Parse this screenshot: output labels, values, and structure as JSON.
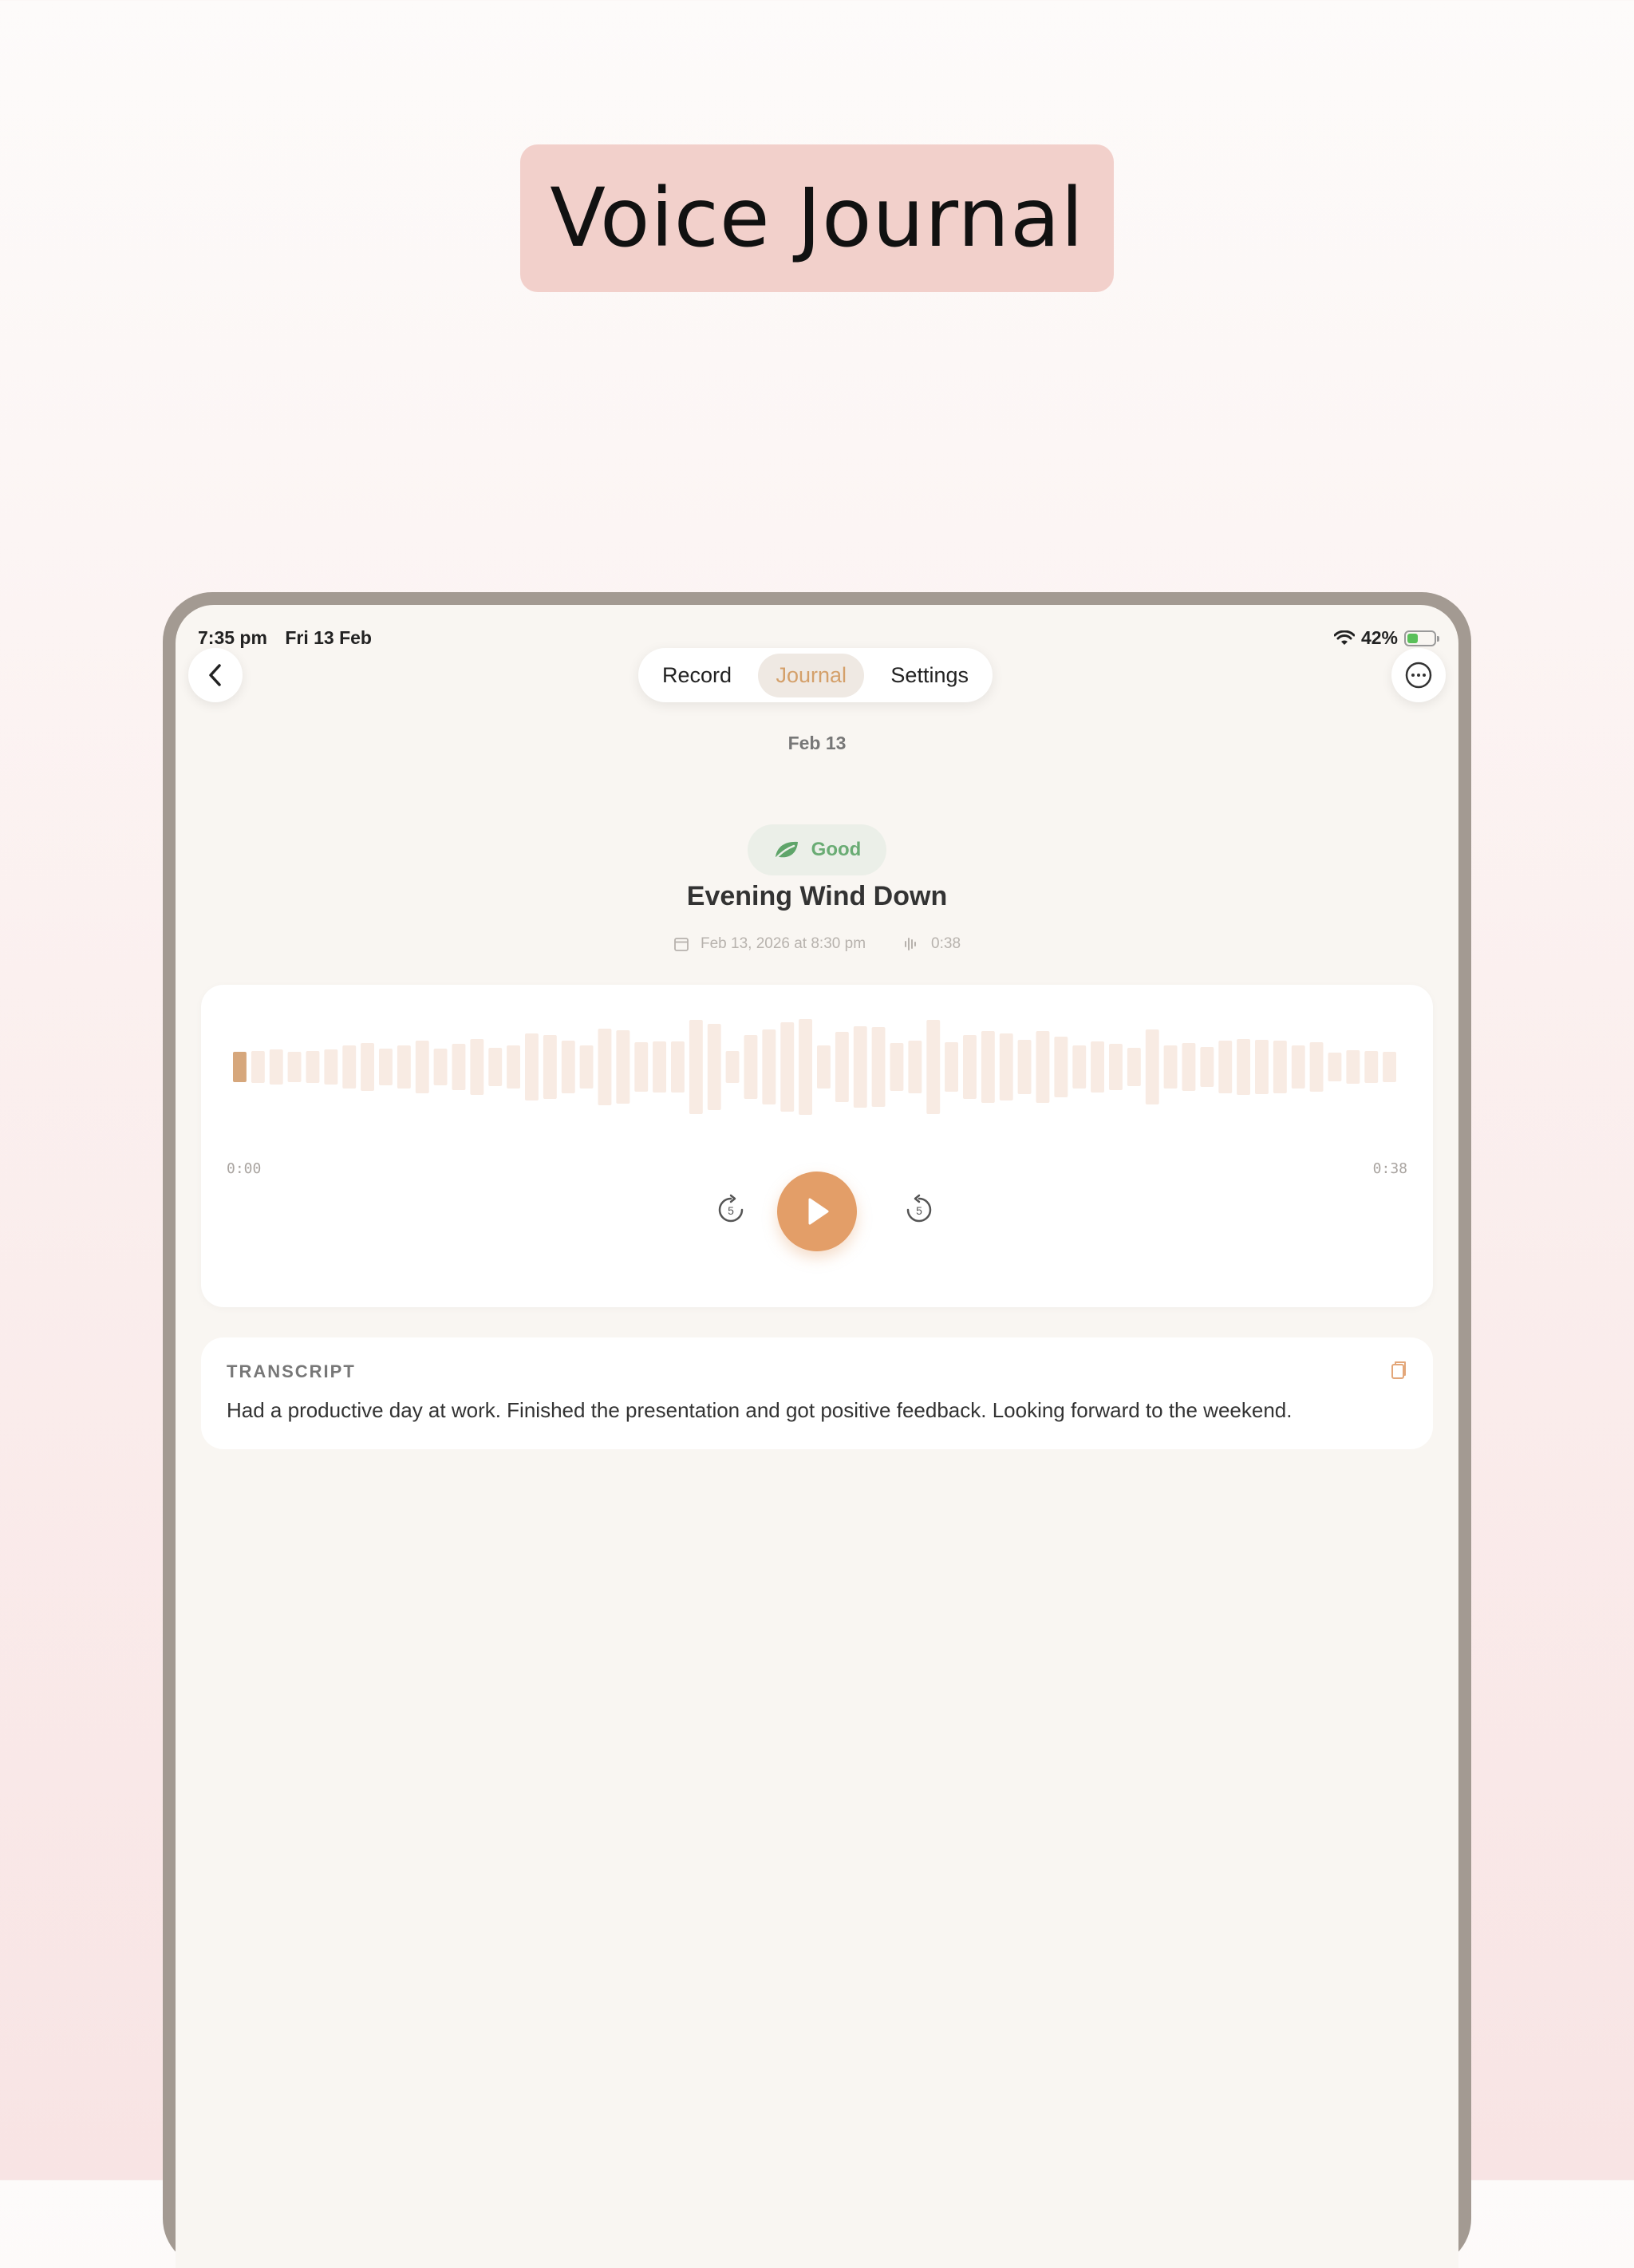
{
  "promo": {
    "title": "Voice Journal"
  },
  "status_bar": {
    "time": "7:35 pm",
    "date": "Fri 13 Feb",
    "battery": "42%",
    "battery_level": 0.42
  },
  "nav": {
    "back_icon": "chevron-left-icon",
    "more_icon": "ellipsis-circle-icon",
    "tabs": [
      {
        "label": "Record",
        "active": false
      },
      {
        "label": "Journal",
        "active": true
      },
      {
        "label": "Settings",
        "active": false
      }
    ]
  },
  "page": {
    "date_header": "Feb 13"
  },
  "entry": {
    "mood": "Good",
    "mood_icon": "leaf-icon",
    "title": "Evening Wind Down",
    "datetime": "Feb 13, 2026 at 8:30 pm",
    "duration": "0:38"
  },
  "player": {
    "current_time": "0:00",
    "total_time": "0:38",
    "skip_back_label": "5",
    "skip_forward_label": "5",
    "progress": 0.0
  },
  "transcript": {
    "label": "TRANSCRIPT",
    "text": "Had a productive day at work. Finished the presentation and got positive feedback. Looking forward to the weekend."
  },
  "colors": {
    "accent": "#e39e68",
    "tab_active": "#d4a06a",
    "mood_green": "#6aac74",
    "promo_bg": "#f2d0cb"
  }
}
